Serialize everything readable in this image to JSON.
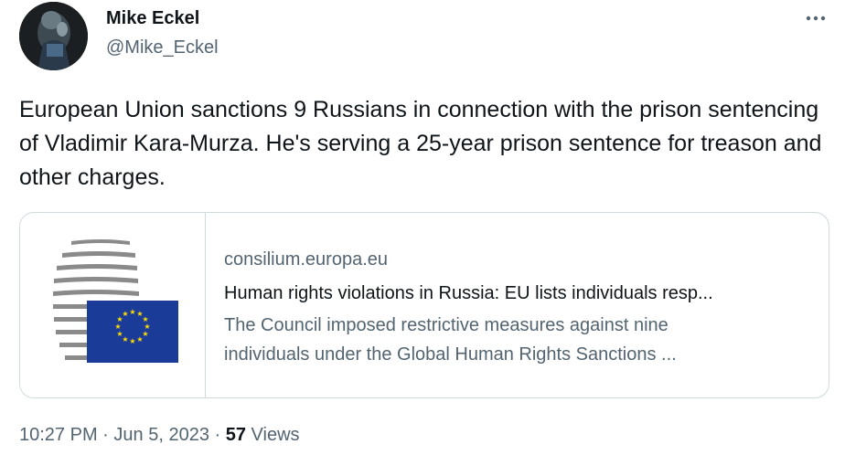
{
  "author": {
    "display_name": "Mike Eckel",
    "handle": "@Mike_Eckel"
  },
  "tweet": {
    "text": "European Union sanctions 9 Russians in connection with the prison sentencing of Vladimir Kara-Murza. He's serving a 25-year prison sentence for treason and other charges."
  },
  "card": {
    "domain": "consilium.europa.eu",
    "title": "Human rights violations in Russia: EU lists individuals resp...",
    "description_line1": "The Council imposed restrictive measures against nine",
    "description_line2": "individuals under the Global Human Rights Sanctions ..."
  },
  "meta": {
    "time": "10:27 PM",
    "separator1": "·",
    "date": "Jun 5, 2023",
    "separator2": "·",
    "views_count": "57",
    "views_label": "Views"
  },
  "icons": {
    "more": "more-horizontal-icon",
    "card_logo": "council-eu-logo"
  },
  "colors": {
    "text_primary": "#0f1419",
    "text_secondary": "#536471",
    "border": "#cfd9de",
    "eu_blue": "#1a3b97",
    "eu_star": "#ffdd00"
  }
}
